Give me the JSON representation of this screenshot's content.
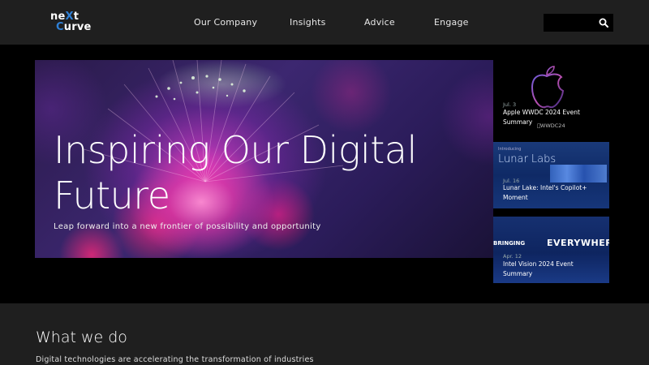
{
  "logo": {
    "line1_prefix": "ne",
    "line1_x": "X",
    "line1_suffix": "t",
    "line2_prefix": "C",
    "line2_suffix": "urve"
  },
  "nav": {
    "items": [
      {
        "label": "Our Company"
      },
      {
        "label": "Insights"
      },
      {
        "label": "Advice"
      },
      {
        "label": "Engage"
      }
    ]
  },
  "search": {
    "placeholder": "",
    "icon": "search-icon"
  },
  "hero": {
    "title": "Inspiring Our Digital Future",
    "subtitle": "Leap forward into a new frontier of possibility and opportunity"
  },
  "cards": [
    {
      "date": "Jul. 3",
      "title": "Apple WWDC 2024 Event Summary",
      "image_caption": "WWDC24"
    },
    {
      "date": "Jul. 16",
      "title": "Lunar Lake: Intel's Copilot+ Moment",
      "image_caption": "Lunar Labs",
      "image_caption_small": "Introducing"
    },
    {
      "date": "Apr. 12",
      "title": "Intel Vision 2024 Event Summary",
      "image_caption": "EVERYWHERE",
      "image_caption_left": "BRINGING"
    }
  ],
  "section": {
    "title": "What we do",
    "text": "Digital technologies are accelerating the transformation of industries"
  },
  "colors": {
    "header_bg": "#1f1f1f",
    "logo_accent": "#2f80d6",
    "page_bg": "#000000"
  }
}
